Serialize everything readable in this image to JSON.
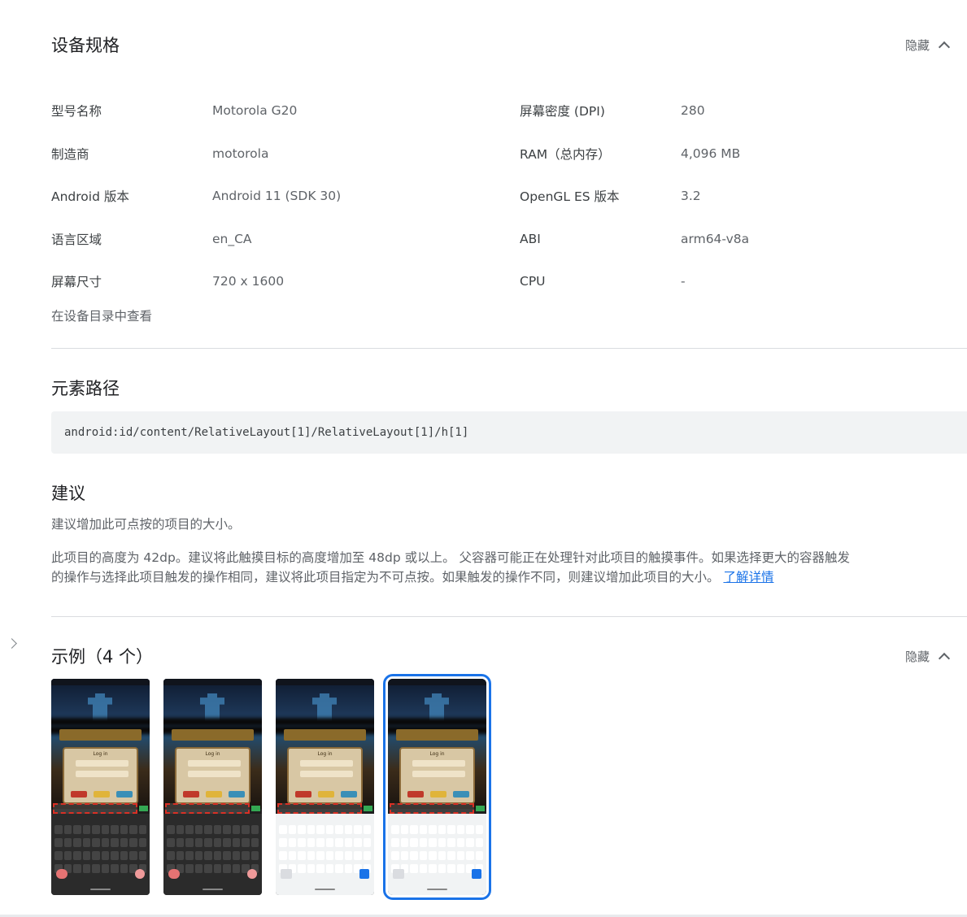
{
  "device_specs": {
    "title": "设备规格",
    "toggle_label": "隐藏",
    "rows": [
      {
        "label": "型号名称",
        "value": "Motorola G20",
        "label2": "屏幕密度 (DPI)",
        "value2": "280"
      },
      {
        "label": "制造商",
        "value": "motorola",
        "label2": "RAM（总内存）",
        "value2": "4,096 MB"
      },
      {
        "label": "Android 版本",
        "value": "Android 11 (SDK 30)",
        "label2": "OpenGL ES 版本",
        "value2": "3.2"
      },
      {
        "label": "语言区域",
        "value": "en_CA",
        "label2": "ABI",
        "value2": "arm64-v8a"
      },
      {
        "label": "屏幕尺寸",
        "value": "720 x 1600",
        "label2": "CPU",
        "value2": "-"
      }
    ],
    "catalog_link": "在设备目录中查看"
  },
  "element_path": {
    "title": "元素路径",
    "path": "android:id/content/RelativeLayout[1]/RelativeLayout[1]/h[1]"
  },
  "suggestion": {
    "title": "建议",
    "summary": "建议增加此可点按的项目的大小。",
    "detail_line1": "此项目的高度为 42dp。建议将此触摸目标的高度增加至 48dp 或以上。 父容器可能正在处理针对此项目的触摸事件。如果选择更大的容器触发",
    "detail_line2": "的操作与选择此项目触发的操作相同，建议将此项目指定为不可点按。如果触发的操作不同，则建议增加此项目的大小。",
    "learn_more": "了解详情"
  },
  "examples": {
    "title": "示例（4 个）",
    "toggle_label": "隐藏",
    "thumbnails": [
      {
        "theme": "dark",
        "selected": false,
        "dialog_title": "Log in"
      },
      {
        "theme": "dark",
        "selected": false,
        "dialog_title": "Log in"
      },
      {
        "theme": "light",
        "selected": false,
        "dialog_title": "Log in"
      },
      {
        "theme": "light",
        "selected": true,
        "dialog_title": "Log in"
      }
    ]
  },
  "colors": {
    "accent": "#1a73e8",
    "target_highlight": "#d93025",
    "path_background": "#f1f3f4"
  }
}
